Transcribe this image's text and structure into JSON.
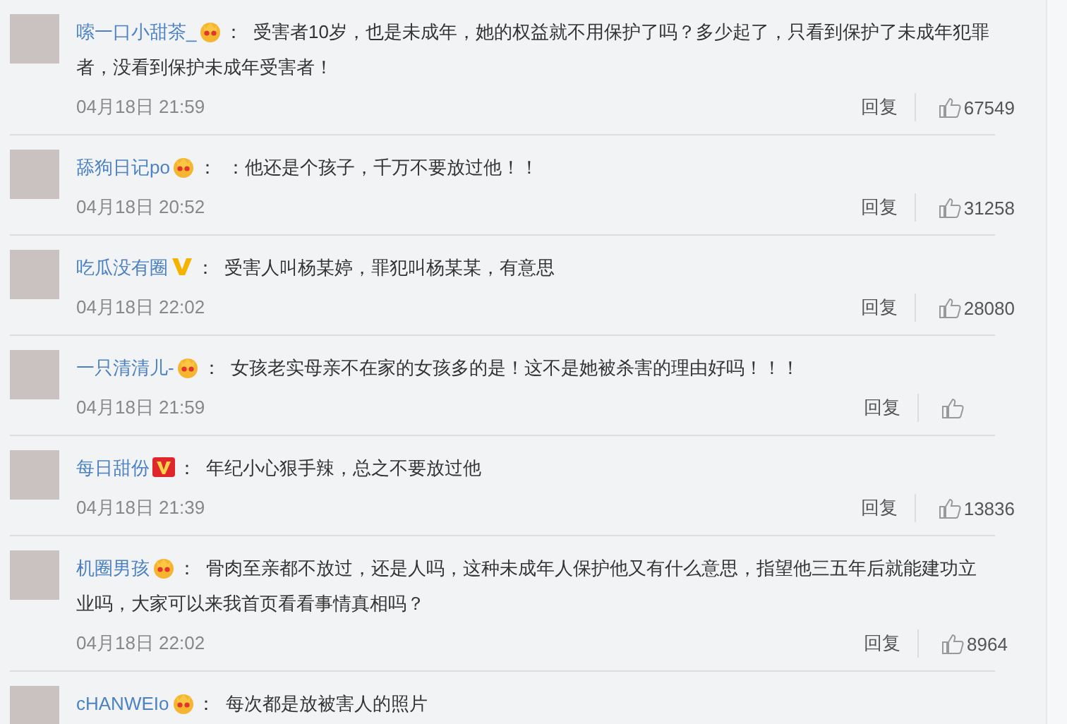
{
  "comments": [
    {
      "user": "嗦一口小甜茶_",
      "badge": {
        "kind": "crown"
      },
      "text": "：  受害者10岁，也是未成年，她的权益就不用保护了吗？多少起了，只看到保护了未成年犯罪者，没看到保护未成年受害者！",
      "time": "04月18日 21:59",
      "reply": "回复",
      "likes": "67549"
    },
    {
      "user": "舔狗日记po",
      "badge": {
        "kind": "crown"
      },
      "text": "：  ：他还是个孩子，千万不要放过他！！",
      "time": "04月18日 20:52",
      "reply": "回复",
      "likes": "31258"
    },
    {
      "user": "吃瓜没有圈",
      "badge": {
        "kind": "v-gold"
      },
      "text": "：  受害人叫杨某婷，罪犯叫杨某某，有意思",
      "time": "04月18日 22:02",
      "reply": "回复",
      "likes": "28080"
    },
    {
      "user": "一只清清儿-",
      "badge": {
        "kind": "crown"
      },
      "text": "：  女孩老实母亲不在家的女孩多的是！这不是她被杀害的理由好吗！！！",
      "time": "04月18日 21:59",
      "reply": "回复"
    },
    {
      "user": "每日甜份",
      "badge": {
        "kind": "v-red"
      },
      "text": "：  年纪小心狠手辣，总之不要放过他",
      "time": "04月18日 21:39",
      "reply": "回复",
      "likes": "13836"
    },
    {
      "user": "机圈男孩",
      "badge": {
        "kind": "crown"
      },
      "text": "：  骨肉至亲都不放过，还是人吗，这种未成年人保护他又有什么意思，指望他三五年后就能建功立业吗，大家可以来我首页看看事情真相吗？",
      "time": "04月18日 22:02",
      "reply": "回复",
      "likes": "8964"
    },
    {
      "user": "cHANWEIo",
      "badge": {
        "kind": "crown"
      },
      "text": "：  每次都是放被害人的照片"
    }
  ]
}
